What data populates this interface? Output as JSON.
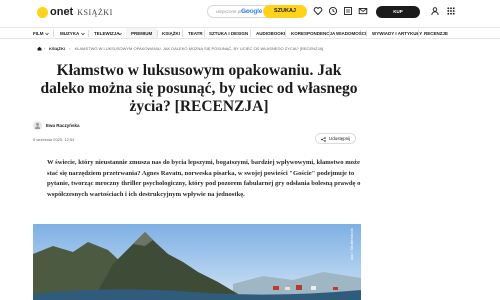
{
  "header": {
    "logo_text": "onet",
    "logo_section": "KSIĄŻKI",
    "search_placeholder": "ulepszone przez",
    "search_google": "Google",
    "search_button": "SZUKAJ",
    "subscribe_button": "KUP SUBSKRYPCJĘ"
  },
  "nav": {
    "items": [
      "FILM",
      "MUZYKA",
      "TELEWIZJA",
      "PREMIUM",
      "KSIĄŻKI",
      "TEATR",
      "SZTUKA I DESIGN",
      "AUDIOBOOKI",
      "KORESPONDENCJA",
      "WIADOMOŚCI",
      "WYWIADY I ARTYKUŁY",
      "RECENZJE"
    ]
  },
  "breadcrumb": {
    "section": "KSIĄŻKI",
    "current": "KŁAMSTWO W LUKSUSOWYM OPAKOWANIU. JAK DALEKO MOŻNA SIĘ POSUNĄĆ, BY UCIEC OD WŁASNEGO ŻYCIA? [RECENZJA]"
  },
  "article": {
    "title": "Kłamstwo w luksusowym opakowaniu. Jak daleko można się posunąć, by uciec od własnego życia? [RECENZJA]",
    "author": "Ewa Raczyńska",
    "date": "6 września 2025, 12:54",
    "share_label": "Udostępnij",
    "lead": "W świecie, który nieustannie zmusza nas do bycia lepszymi, bogatszymi, bardziej wpływowymi, kłamstwo może stać się narzędziem przetrwania? Agnes Ravatn, norweska pisarka, w swojej powieści \"Goście\" podejmuje to pytanie, tworząc mroczny thriller psychologiczny, który pod pozorem fabularnej gry odsłania bolesną prawdę o współczesnych wartościach i ich destrukcyjnym wpływie na jednostkę.",
    "photo_credit": "xxx / Shutterstock"
  },
  "colors": {
    "brand_yellow": "#ffd31a",
    "text": "#1b1b1b",
    "sky": "#8fb8e6"
  }
}
